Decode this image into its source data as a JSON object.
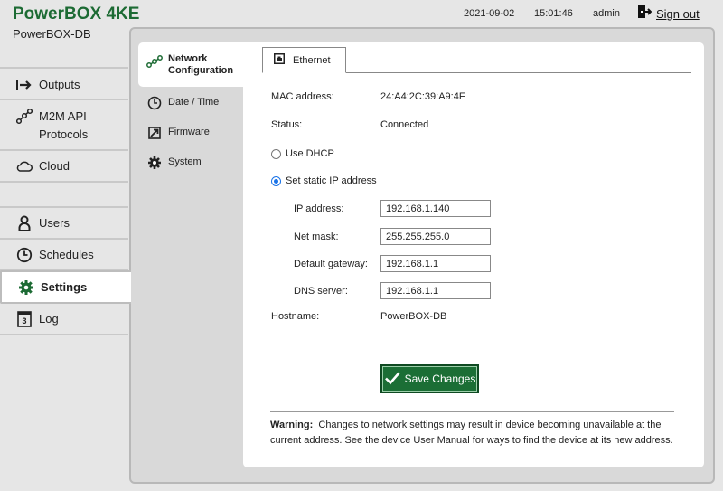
{
  "header": {
    "brand": "PowerBOX 4KE",
    "device_name": "PowerBOX-DB",
    "date": "2021-09-02",
    "time": "15:01:46",
    "user": "admin",
    "signout_label": "Sign out",
    "signout_icon": "sign-out-icon"
  },
  "nav": {
    "outputs": "Outputs",
    "m2m_line1": "M2M API",
    "m2m_line2": "Protocols",
    "cloud": "Cloud",
    "users": "Users",
    "schedules": "Schedules",
    "settings": "Settings",
    "log": "Log"
  },
  "subnav": {
    "network_line1": "Network",
    "network_line2": "Configuration",
    "datetime": "Date / Time",
    "firmware": "Firmware",
    "system": "System"
  },
  "tab": {
    "ethernet": "Ethernet"
  },
  "network": {
    "mac_label": "MAC address:",
    "mac_value": "24:A4:2C:39:A9:4F",
    "status_label": "Status:",
    "status_value": "Connected",
    "dhcp_label": "Use DHCP",
    "static_label": "Set static IP address",
    "selected_mode": "static",
    "ip_label": "IP address:",
    "ip_value": "192.168.1.140",
    "mask_label": "Net mask:",
    "mask_value": "255.255.255.0",
    "gateway_label": "Default gateway:",
    "gateway_value": "192.168.1.1",
    "dns_label": "DNS server:",
    "dns_value": "192.168.1.1",
    "hostname_label": "Hostname:",
    "hostname_value": "PowerBOX-DB"
  },
  "actions": {
    "save_label": "Save Changes"
  },
  "warning": {
    "title": "Warning:",
    "text": "Changes to network settings may result in device becoming unavailable at the current address. See the device User Manual for ways to find the device at its new address."
  },
  "colors": {
    "brand": "#1d6b34",
    "save_button": "#1b6e35",
    "radio_selected": "#1a73e8"
  }
}
